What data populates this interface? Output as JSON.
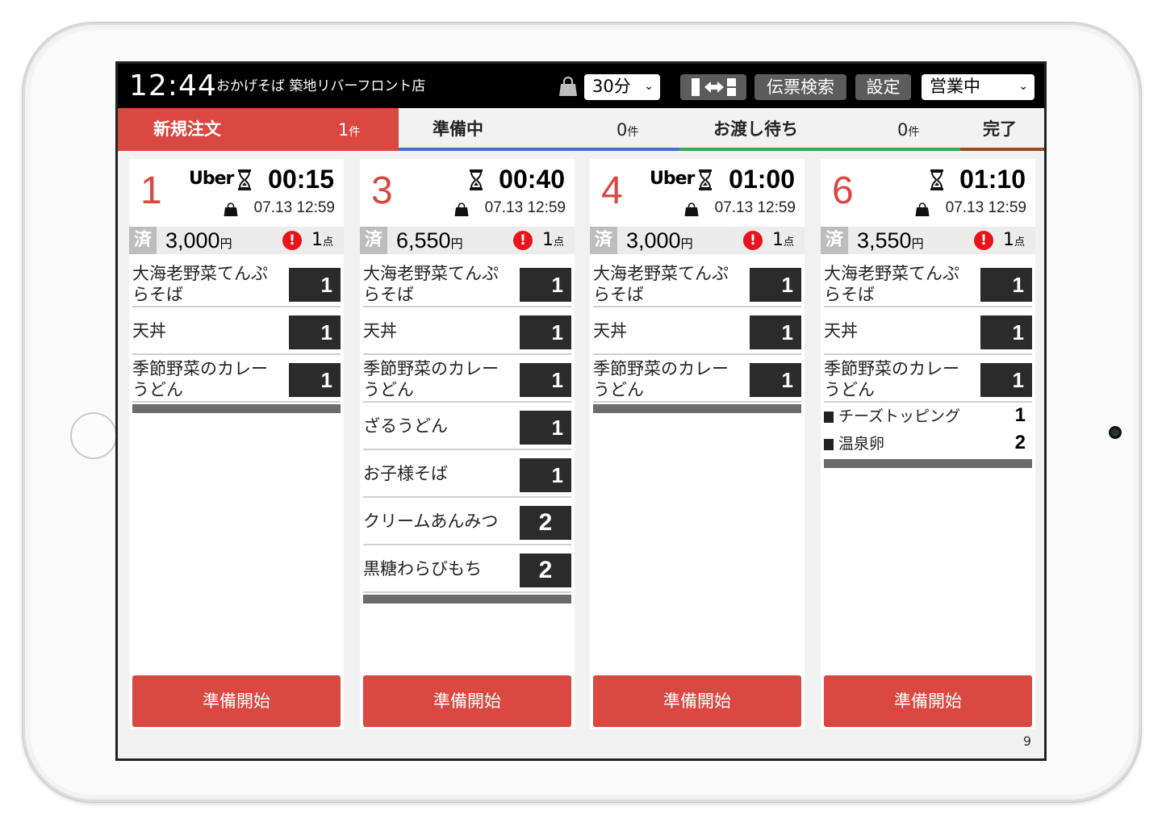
{
  "header": {
    "clock": "12:44",
    "store_name": "おかげそば 築地リバーフロント店",
    "time_select": "30分",
    "search_label": "伝票検索",
    "settings_label": "設定",
    "status_select": "営業中"
  },
  "tabs": [
    {
      "label": "新規注文",
      "count": "1",
      "unit": "件",
      "color": "#d94841"
    },
    {
      "label": "準備中",
      "count": "0",
      "unit": "件",
      "color": "#3f6fd1"
    },
    {
      "label": "お渡し待ち",
      "count": "0",
      "unit": "件",
      "color": "#3ba852"
    },
    {
      "label": "完了",
      "color": "#9a4a1c"
    }
  ],
  "cards": [
    {
      "number": "1",
      "uber": "Uber",
      "timer": "00:15",
      "datetime": "07.13 12:59",
      "paid": "済",
      "amount": "3,000",
      "yen": "円",
      "points": "1",
      "points_unit": "点",
      "items": [
        {
          "name": "大海老野菜てんぷらそば",
          "qty": "1"
        },
        {
          "name": "天丼",
          "qty": "1"
        },
        {
          "name": "季節野菜のカレーうどん",
          "qty": "1"
        }
      ],
      "toppings": [],
      "button": "準備開始"
    },
    {
      "number": "3",
      "uber": "",
      "timer": "00:40",
      "datetime": "07.13 12:59",
      "paid": "済",
      "amount": "6,550",
      "yen": "円",
      "points": "1",
      "points_unit": "点",
      "items": [
        {
          "name": "大海老野菜てんぷらそば",
          "qty": "1"
        },
        {
          "name": "天丼",
          "qty": "1"
        },
        {
          "name": "季節野菜のカレーうどん",
          "qty": "1"
        },
        {
          "name": "ざるうどん",
          "qty": "1"
        },
        {
          "name": "お子様そば",
          "qty": "1"
        },
        {
          "name": "クリームあんみつ",
          "qty": "2"
        },
        {
          "name": "黒糖わらびもち",
          "qty": "2"
        }
      ],
      "toppings": [],
      "button": "準備開始"
    },
    {
      "number": "4",
      "uber": "Uber",
      "timer": "01:00",
      "datetime": "07.13 12:59",
      "paid": "済",
      "amount": "3,000",
      "yen": "円",
      "points": "1",
      "points_unit": "点",
      "items": [
        {
          "name": "大海老野菜てんぷらそば",
          "qty": "1"
        },
        {
          "name": "天丼",
          "qty": "1"
        },
        {
          "name": "季節野菜のカレーうどん",
          "qty": "1"
        }
      ],
      "toppings": [],
      "button": "準備開始"
    },
    {
      "number": "6",
      "uber": "",
      "timer": "01:10",
      "datetime": "07.13 12:59",
      "paid": "済",
      "amount": "3,550",
      "yen": "円",
      "points": "1",
      "points_unit": "点",
      "items": [
        {
          "name": "大海老野菜てんぷらそば",
          "qty": "1"
        },
        {
          "name": "天丼",
          "qty": "1"
        },
        {
          "name": "季節野菜のカレーうどん",
          "qty": "1"
        }
      ],
      "toppings": [
        {
          "name": "チーズトッピング",
          "qty": "1"
        },
        {
          "name": "温泉卵",
          "qty": "2"
        }
      ],
      "button": "準備開始"
    }
  ],
  "page_number": "9",
  "icons": {
    "bag": "shopping-bag-icon",
    "hourglass": "hourglass-icon",
    "alert": "alert-icon",
    "layout": "layout-swap-icon",
    "chevron": "chevron-down-icon"
  }
}
